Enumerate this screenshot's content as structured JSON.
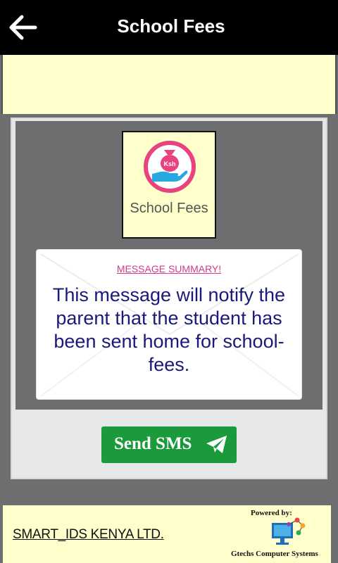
{
  "header": {
    "title": "School Fees",
    "back_icon": "arrow-left-icon"
  },
  "fee_tile": {
    "label": "School Fees",
    "icon": "money-bag-hand-icon",
    "icon_text": "Ksh"
  },
  "message": {
    "heading": "MESSAGE SUMMARY!",
    "body": "This message will notify the parent that the student has been sent home for school-fees."
  },
  "send_button": {
    "label": "Send SMS",
    "icon": "paper-plane-icon"
  },
  "footer": {
    "company": "SMART_IDS KENYA LTD.",
    "powered_by": "Powered by:",
    "brand_name": "Gtechs Computer Systems"
  },
  "colors": {
    "topbar": "#000000",
    "band": "#ffffcc",
    "panel": "#6d6e70",
    "accent_pink": "#e8437e",
    "button_green": "#1a9a3a",
    "message_text": "#1a1a7a"
  }
}
